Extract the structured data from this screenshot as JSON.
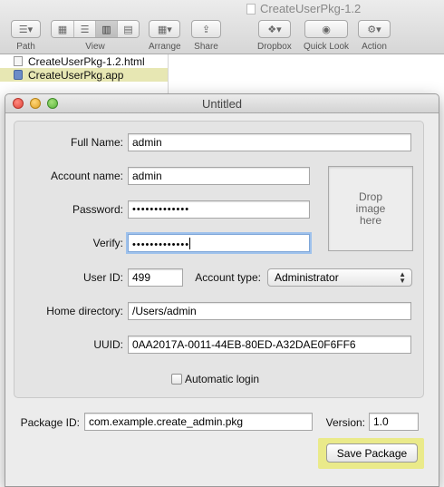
{
  "finder": {
    "window_title": "CreateUserPkg-1.2",
    "toolbar": {
      "path_label": "Path",
      "view_label": "View",
      "arrange_label": "Arrange",
      "share_label": "Share",
      "dropbox_label": "Dropbox",
      "quicklook_label": "Quick Look",
      "action_label": "Action"
    },
    "files": [
      {
        "name": "CreateUserPkg-1.2.html",
        "icon": "html-file-icon"
      },
      {
        "name": "CreateUserPkg.app",
        "icon": "app-icon",
        "selected": true
      }
    ]
  },
  "dialog": {
    "title": "Untitled",
    "full_name": {
      "label": "Full Name:",
      "value": "admin"
    },
    "account_name": {
      "label": "Account name:",
      "value": "admin"
    },
    "password": {
      "label": "Password:",
      "value": "•••••••••••••"
    },
    "verify": {
      "label": "Verify:",
      "value": "•••••••••••••"
    },
    "drop_image": {
      "line1": "Drop",
      "line2": "image",
      "line3": "here"
    },
    "user_id": {
      "label": "User ID:",
      "value": "499"
    },
    "account_type": {
      "label": "Account type:",
      "value": "Administrator"
    },
    "home_directory": {
      "label": "Home directory:",
      "value": "/Users/admin"
    },
    "uuid": {
      "label": "UUID:",
      "value": "0AA2017A-0011-44EB-80ED-A32DAE0F6FF6"
    },
    "automatic_login": {
      "label": "Automatic login",
      "checked": false
    },
    "package_id": {
      "label": "Package ID:",
      "value": "com.example.create_admin.pkg"
    },
    "version": {
      "label": "Version:",
      "value": "1.0"
    },
    "save_button": "Save Package"
  },
  "colors": {
    "highlight": "#eaea8a",
    "focus_ring": "#9ec1ec",
    "selected_file": "#e7e7b3"
  }
}
